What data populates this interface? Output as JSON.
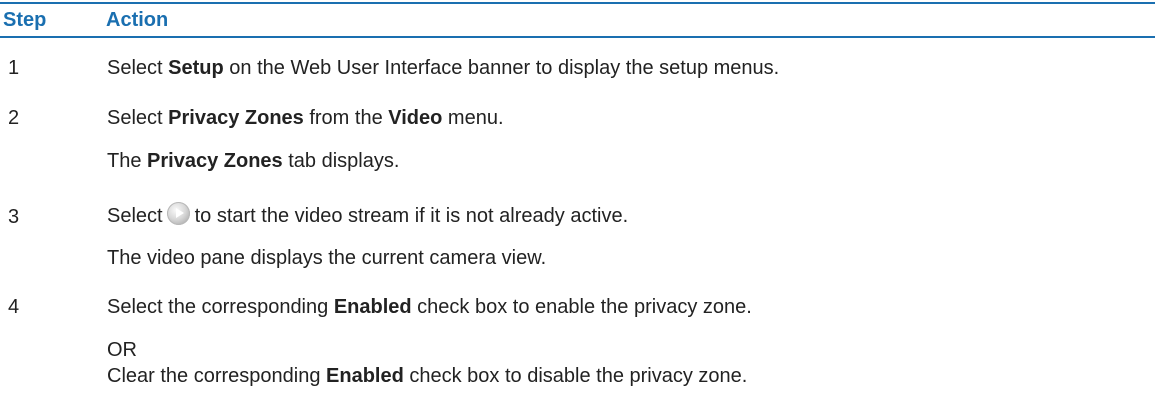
{
  "table": {
    "header": {
      "step": "Step",
      "action": "Action"
    },
    "rows": [
      {
        "step": "1",
        "action": {
          "pre": "Select ",
          "bold1": "Setup",
          "post": " on the Web User Interface banner to display the setup menus."
        }
      },
      {
        "step": "2",
        "action": {
          "pre": "Select ",
          "bold1": "Privacy Zones",
          "mid": " from the ",
          "bold2": "Video",
          "post": " menu."
        },
        "result": {
          "pre": "The ",
          "bold1": "Privacy Zones",
          "post": " tab displays."
        }
      },
      {
        "step": "3",
        "action": {
          "pre": "Select",
          "icon": "play-icon",
          "post": "to start the video stream if it is not already active."
        },
        "result": "The video pane displays the current camera view."
      },
      {
        "step": "4",
        "action": {
          "pre": "Select the corresponding ",
          "bold1": "Enabled",
          "post": " check box to enable the privacy zone."
        },
        "or_text": "OR",
        "alt_action": {
          "pre": "Clear the corresponding ",
          "bold1": "Enabled",
          "post": " check box to disable the privacy zone."
        }
      }
    ]
  },
  "colors": {
    "header_text": "#1a6fb0",
    "rule": "#1a6fb0",
    "body_text": "#222222"
  }
}
